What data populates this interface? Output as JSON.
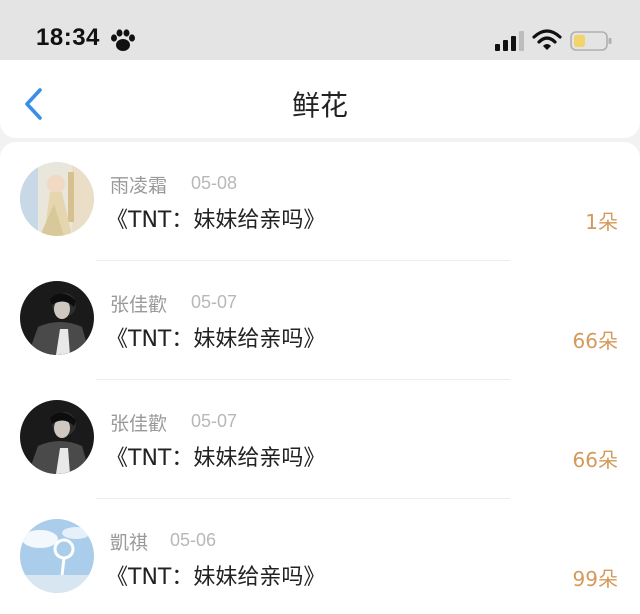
{
  "status_bar": {
    "time": "18:34",
    "icons": [
      "paw-icon",
      "signal-icon",
      "wifi-icon",
      "battery-icon"
    ]
  },
  "nav": {
    "title": "鲜花",
    "back_icon": "back-chevron-icon"
  },
  "colors": {
    "accent_blue": "#3a8ee6",
    "count_orange": "#d49a5a",
    "name_gray": "#999999",
    "battery_yellow": "#f3d36b"
  },
  "flowers": [
    {
      "name": "雨凌霜",
      "date": "05-08",
      "title": "《TNT：妹妹给亲吗》",
      "count": "1朵"
    },
    {
      "name": "张佳歡",
      "date": "05-07",
      "title": "《TNT：妹妹给亲吗》",
      "count": "66朵"
    },
    {
      "name": "张佳歡",
      "date": "05-07",
      "title": "《TNT：妹妹给亲吗》",
      "count": "66朵"
    },
    {
      "name": "凱祺",
      "date": "05-06",
      "title": "《TNT：妹妹给亲吗》",
      "count": "99朵"
    }
  ]
}
